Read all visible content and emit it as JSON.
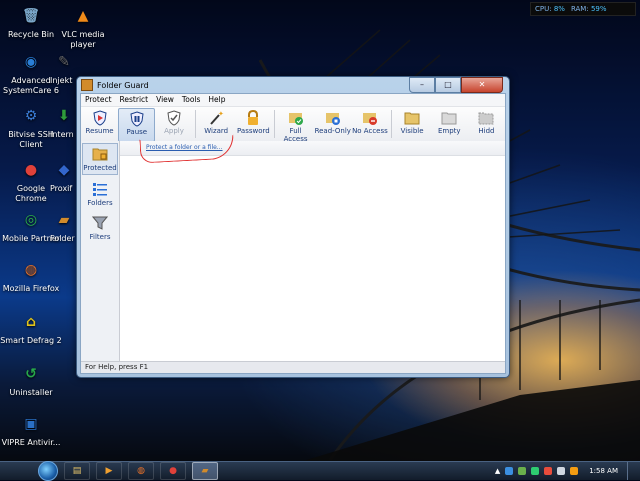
{
  "desktop": {
    "icons": [
      {
        "label": "Recycle Bin",
        "icon": "recycle-bin-icon",
        "color": "#7aa6c9",
        "glyph": "🗑"
      },
      {
        "label": "VLC media player",
        "icon": "vlc-icon",
        "color": "#f08a1a",
        "glyph": "▲"
      },
      {
        "label": "Advanced SystemCare 6",
        "icon": "systemcare-icon",
        "color": "#2a7fd6",
        "glyph": "◉"
      },
      {
        "label": "Injekt",
        "icon": "injekt-icon",
        "color": "#666",
        "glyph": "✎"
      },
      {
        "label": "Bitvise SSH Client",
        "icon": "bitvise-icon",
        "color": "#3b7dd8",
        "glyph": "⚙"
      },
      {
        "label": "Intern Downl",
        "icon": "idm-icon",
        "color": "#2e9c3b",
        "glyph": "⬇"
      },
      {
        "label": "Google Chrome",
        "icon": "chrome-icon",
        "color": "#e0413a",
        "glyph": "●"
      },
      {
        "label": "Proxif",
        "icon": "proxifier-icon",
        "color": "#3366cc",
        "glyph": "◆"
      },
      {
        "label": "Mobile Partner",
        "icon": "mobile-partner-icon",
        "color": "#2db34a",
        "glyph": "◎"
      },
      {
        "label": "Folder G",
        "icon": "folder-guard-icon",
        "color": "#d28b2b",
        "glyph": "▰"
      },
      {
        "label": "Mozilla Firefox",
        "icon": "firefox-icon",
        "color": "#e8722a",
        "glyph": "◍"
      },
      {
        "label": "Smart Defrag 2",
        "icon": "smart-defrag-icon",
        "color": "#e0c21a",
        "glyph": "⌂"
      },
      {
        "label": "Uninstaller",
        "icon": "uninstaller-icon",
        "color": "#27a84a",
        "glyph": "↺"
      },
      {
        "label": "VIPRE Antivir...",
        "icon": "vipre-icon",
        "color": "#2a6fc4",
        "glyph": "▣"
      }
    ]
  },
  "meter": {
    "cpu_label": "CPU:",
    "cpu_value": "8%",
    "ram_label": "RAM:",
    "ram_value": "59%"
  },
  "window": {
    "title": "Folder Guard",
    "controls": {
      "minimize": "–",
      "maximize": "□",
      "close": "✕"
    },
    "menu": [
      "Protect",
      "Restrict",
      "View",
      "Tools",
      "Help"
    ],
    "toolbar": [
      {
        "label": "Resume",
        "icon": "resume-shield-icon",
        "state": "normal"
      },
      {
        "label": "Pause",
        "icon": "pause-shield-icon",
        "state": "active"
      },
      {
        "label": "Apply",
        "icon": "apply-shield-icon",
        "state": "disabled"
      },
      {
        "label": "Wizard",
        "icon": "wizard-wand-icon",
        "state": "normal"
      },
      {
        "label": "Password",
        "icon": "padlock-icon",
        "state": "normal"
      },
      {
        "label": "Full Access",
        "icon": "full-access-icon",
        "state": "normal"
      },
      {
        "label": "Read-Only",
        "icon": "read-only-icon",
        "state": "normal"
      },
      {
        "label": "No Access",
        "icon": "no-access-icon",
        "state": "normal"
      },
      {
        "label": "Visible",
        "icon": "visible-folder-icon",
        "state": "normal"
      },
      {
        "label": "Empty",
        "icon": "empty-folder-icon",
        "state": "normal"
      },
      {
        "label": "Hidd",
        "icon": "hidden-folder-icon",
        "state": "normal"
      }
    ],
    "sidebar": [
      {
        "label": "Protected",
        "icon": "protected-folder-icon",
        "active": true
      },
      {
        "label": "Folders",
        "icon": "folders-list-icon",
        "active": false
      },
      {
        "label": "Filters",
        "icon": "filter-funnel-icon",
        "active": false
      }
    ],
    "main": {
      "link": "Protect a folder or a file..."
    },
    "status": "For Help, press F1"
  },
  "taskbar": {
    "items": [
      {
        "icon": "explorer-icon",
        "glyph": "▤",
        "active": false
      },
      {
        "icon": "media-player-icon",
        "glyph": "▶",
        "active": false
      },
      {
        "icon": "firefox-icon",
        "glyph": "◍",
        "active": false
      },
      {
        "icon": "chrome-icon",
        "glyph": "●",
        "active": false
      },
      {
        "icon": "folder-guard-icon",
        "glyph": "▰",
        "active": true
      }
    ],
    "clock": "1:58 AM"
  },
  "colors": {
    "accent": "#2a5db0",
    "highlight": "#e03030"
  }
}
